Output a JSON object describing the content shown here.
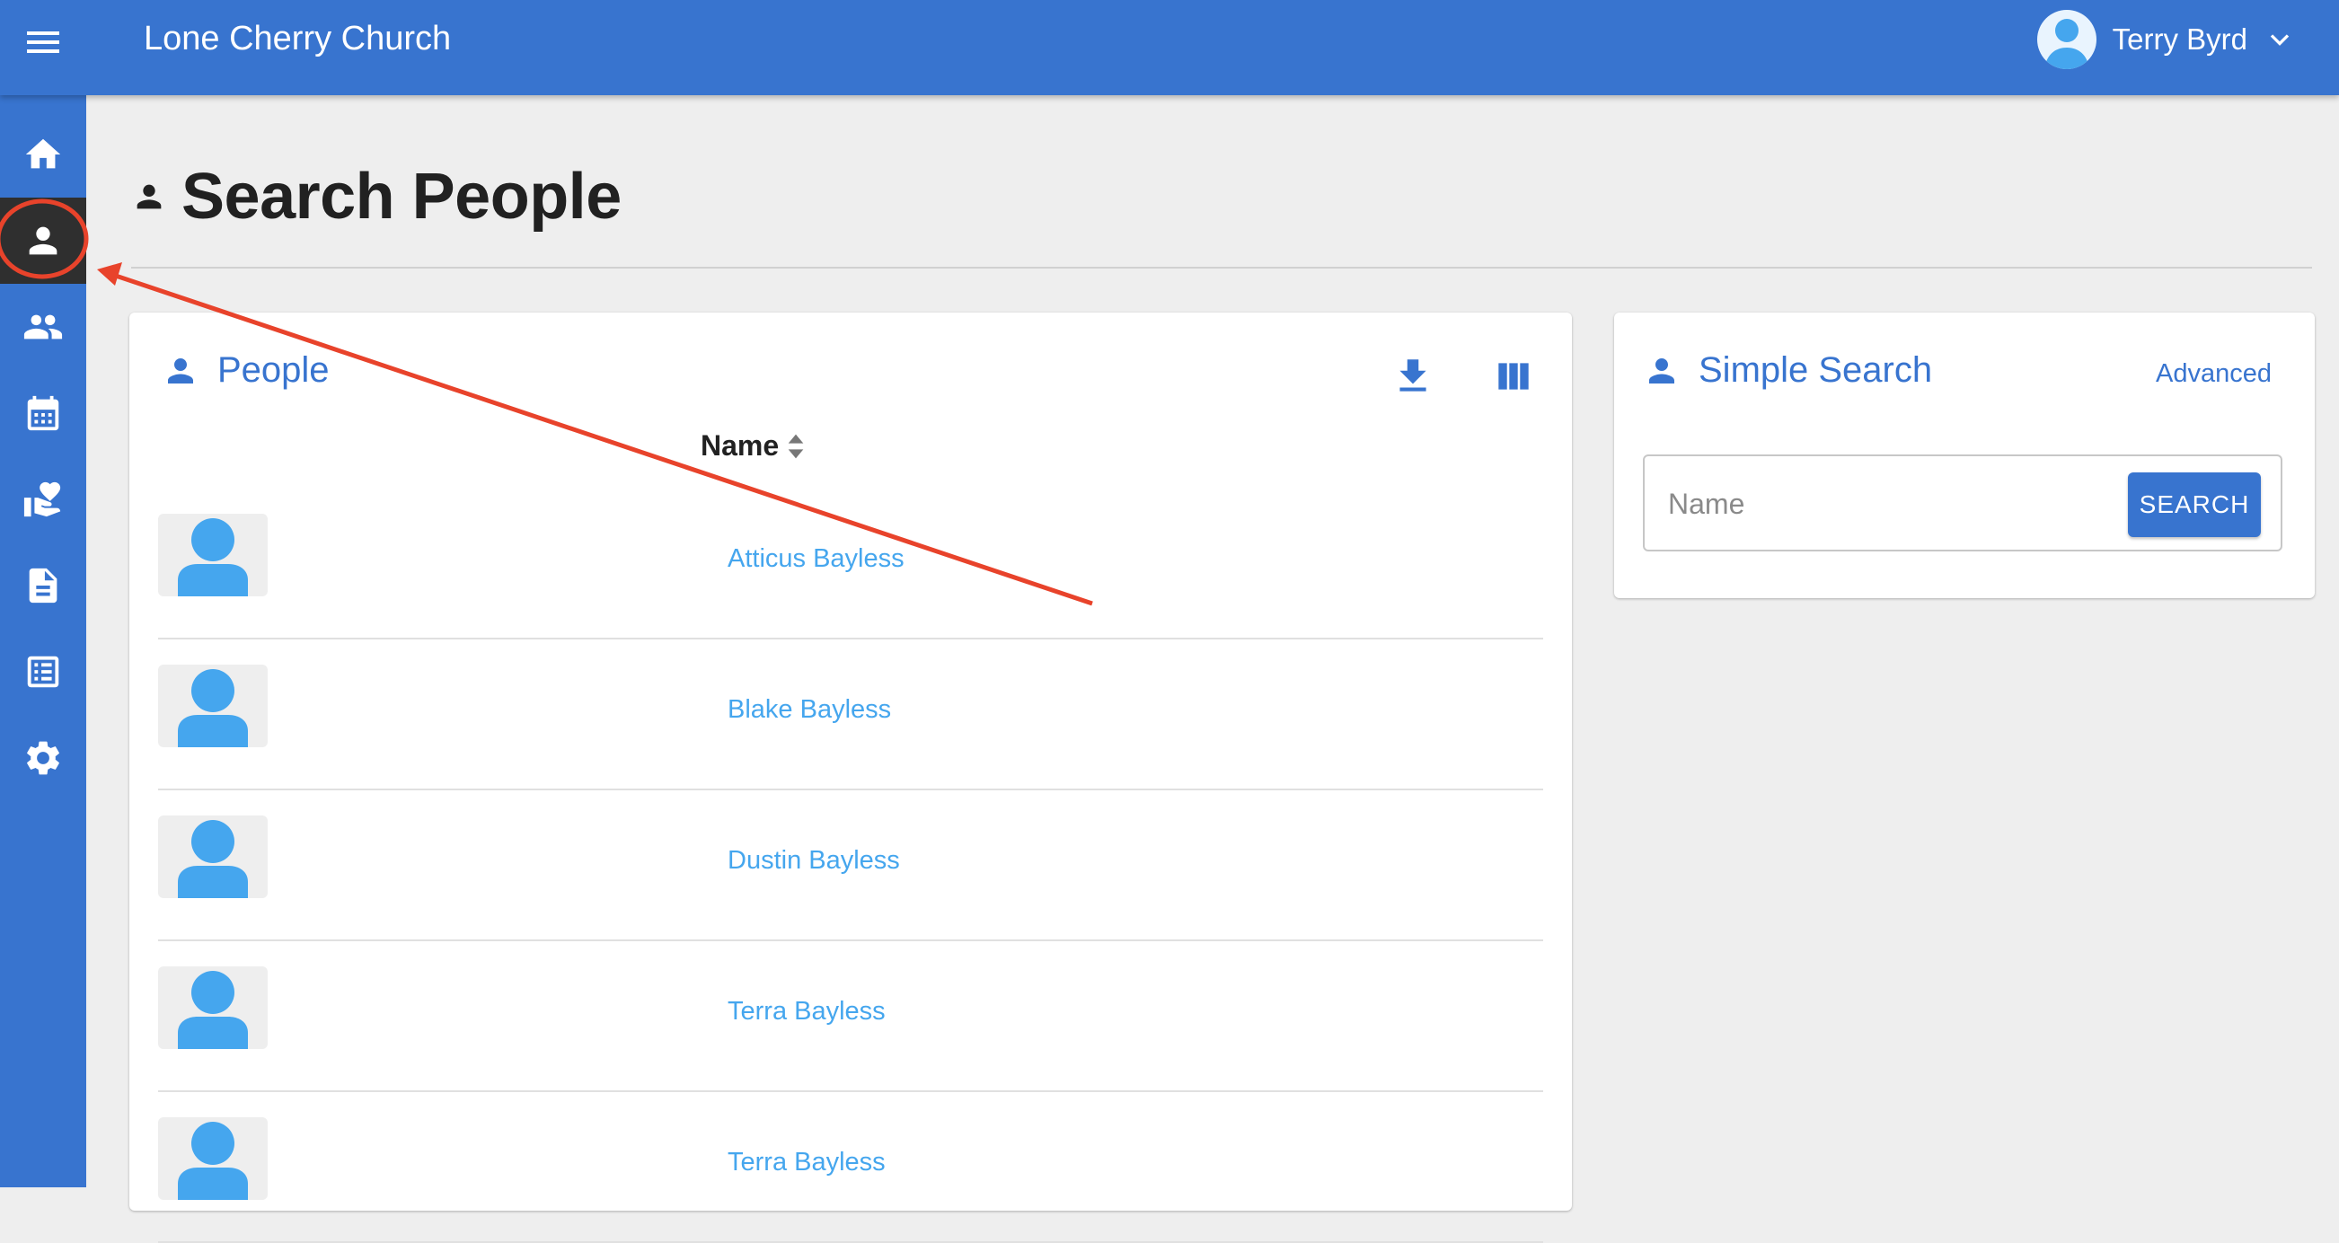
{
  "app": {
    "title": "Lone Cherry Church"
  },
  "user": {
    "name": "Terry Byrd"
  },
  "sidebar": {
    "items": [
      {
        "icon": "home-icon",
        "label": "Dashboard"
      },
      {
        "icon": "person-icon",
        "label": "People",
        "active": true
      },
      {
        "icon": "groups-icon",
        "label": "Groups"
      },
      {
        "icon": "calendar-icon",
        "label": "Attendance"
      },
      {
        "icon": "donations-icon",
        "label": "Donations"
      },
      {
        "icon": "document-icon",
        "label": "Forms"
      },
      {
        "icon": "list-icon",
        "label": "Reports"
      },
      {
        "icon": "gear-icon",
        "label": "Settings"
      }
    ]
  },
  "page": {
    "title": "Search People"
  },
  "people_card": {
    "title": "People",
    "column_header": "Name",
    "rows": [
      {
        "name": "Atticus Bayless"
      },
      {
        "name": "Blake Bayless"
      },
      {
        "name": "Dustin Bayless"
      },
      {
        "name": "Terra Bayless"
      },
      {
        "name": "Terra Bayless"
      }
    ]
  },
  "search_card": {
    "title": "Simple Search",
    "advanced_label": "Advanced",
    "input_value": "",
    "input_placeholder": "Name",
    "button_label": "SEARCH"
  },
  "colors": {
    "primary": "#3874cf",
    "link": "#45a6ee",
    "sidebar_active": "#2f2f2f",
    "annotation": "#e8432b"
  }
}
